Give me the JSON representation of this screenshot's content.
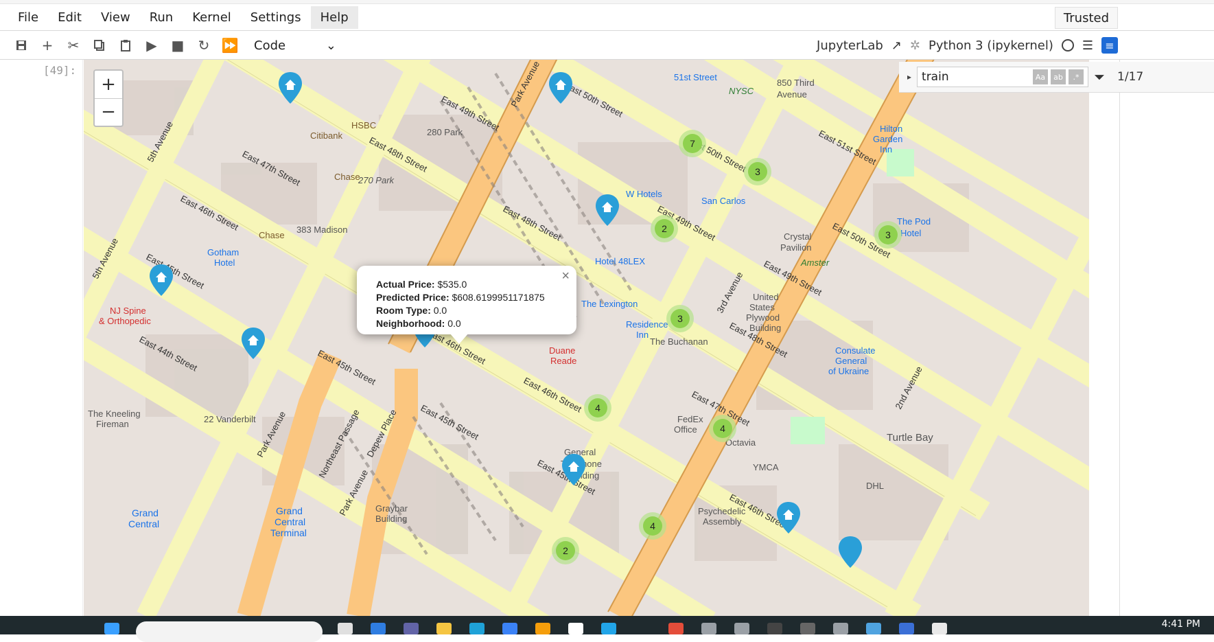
{
  "menu": [
    "File",
    "Edit",
    "View",
    "Run",
    "Kernel",
    "Settings",
    "Help"
  ],
  "trusted_label": "Trusted",
  "toolbar": {
    "cell_type": "Code",
    "jupyterlab_label": "JupyterLab",
    "kernel_label": "Python 3 (ipykernel)"
  },
  "cell": {
    "prompt": "[49]:"
  },
  "search": {
    "query": "train",
    "match_count": "1/17"
  },
  "popup": {
    "actual_price_label": "Actual Price:",
    "actual_price": "$535.0",
    "predicted_price_label": "Predicted Price:",
    "predicted_price": "$608.6199951171875",
    "room_type_label": "Room Type:",
    "room_type": "0.0",
    "neighborhood_label": "Neighborhood:",
    "neighborhood": "0.0",
    "close": "×"
  },
  "map_labels": {
    "streets": [
      "East 49th Street",
      "East 48th Street",
      "East 47th Street",
      "East 46th Street",
      "East 45th Street",
      "East 44th Street",
      "East 50th Street",
      "East 51st Street",
      "Park Avenue",
      "5th Avenue",
      "3rd Avenue",
      "2nd Avenue",
      "Northeast Passage",
      "Depew Place",
      "51st Street"
    ],
    "places": [
      "HSBC",
      "Citibank",
      "Chase",
      "Gotham Hotel",
      "NJ Spine & Orthopedic",
      "The Kneeling Fireman",
      "22 Vanderbilt",
      "383 Madison",
      "270 Park Avenue",
      "280 Park Avenue",
      "W Hotels",
      "San Carlos",
      "Hotel 48LEX",
      "The Lexington",
      "Residence Inn",
      "The Buchanan",
      "Duane Reade",
      "Crystal Pavilion",
      "Amster Yard",
      "United States Plywood Building",
      "Consulate General of Ukraine",
      "Hilton Garden Inn",
      "The Pod Hotel",
      "Turtle Bay",
      "FedEx Office",
      "Octavia",
      "YMCA",
      "Psychedelic Assembly",
      "Grand Central",
      "Grand Central Terminal",
      "Graybar Building",
      "General Telephone Building",
      "DHL",
      "NYSC",
      "850 Third Avenue"
    ]
  },
  "clusters": [
    {
      "count": "7"
    },
    {
      "count": "3"
    },
    {
      "count": "2"
    },
    {
      "count": "3"
    },
    {
      "count": "3"
    },
    {
      "count": "4"
    },
    {
      "count": "4"
    },
    {
      "count": "4"
    },
    {
      "count": "2"
    }
  ],
  "taskbar": {
    "time": "4:41 PM"
  },
  "colors": {
    "accent": "#1e6bd6",
    "marker": "#2a9fd8",
    "cluster": "#8fd14f",
    "street_yellow": "#f7f6b9",
    "avenue_orange": "#fbc67f",
    "map_bg": "#e8e1dc",
    "building": "#d9d0c9"
  }
}
